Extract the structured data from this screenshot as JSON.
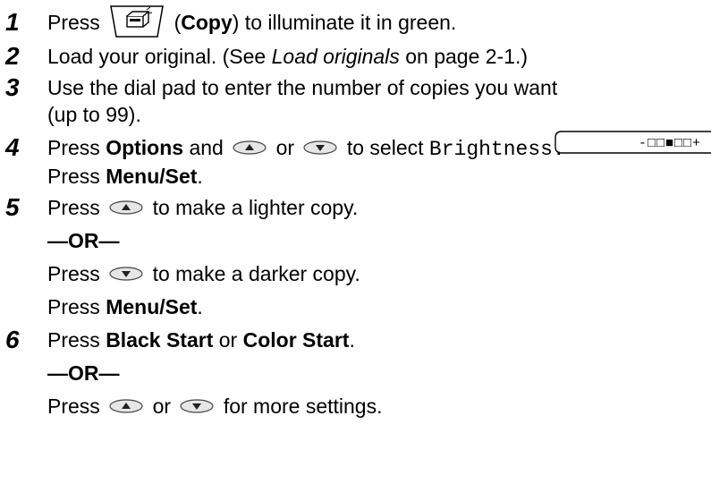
{
  "steps": [
    {
      "number": "1",
      "lines": [
        {
          "a": "Press",
          "b": "(",
          "c": "Copy",
          "d": ") to illuminate it in green."
        }
      ]
    },
    {
      "number": "2",
      "lines": [
        {
          "a": "Load your original. (See ",
          "b": "Load originals",
          "c": " on page 2-1.)"
        }
      ]
    },
    {
      "number": "3",
      "lines": [
        {
          "a": "Use the dial pad to enter the number of copies you want"
        },
        {
          "a": "(up to 99)."
        }
      ]
    },
    {
      "number": "4",
      "lines": [
        {
          "a": "Press ",
          "b": "Options",
          "c": " and",
          "d": "or",
          "e": "to select ",
          "f": "Brightness."
        },
        {
          "a": "Press ",
          "b": "Menu/Set",
          "c": "."
        }
      ]
    },
    {
      "number": "5",
      "lines": [
        {
          "a": "Press",
          "b": "to make a lighter copy."
        },
        {
          "a": "—OR—"
        },
        {
          "a": "Press",
          "b": "to make a darker copy."
        },
        {
          "a": "Press ",
          "b": "Menu/Set",
          "c": "."
        }
      ]
    },
    {
      "number": "6",
      "lines": [
        {
          "a": "Press ",
          "b": "Black Start",
          "c": " or ",
          "d": "Color Start",
          "e": "."
        },
        {
          "a": "—OR—"
        },
        {
          "a": "Press",
          "b": "or",
          "c": "for more settings."
        }
      ]
    }
  ],
  "lcd_display": "-□□■□□+",
  "icons": {
    "copy_key": "copy-key-icon",
    "up_arrow_key": "up-arrow-key-icon",
    "down_arrow_key": "down-arrow-key-icon"
  }
}
